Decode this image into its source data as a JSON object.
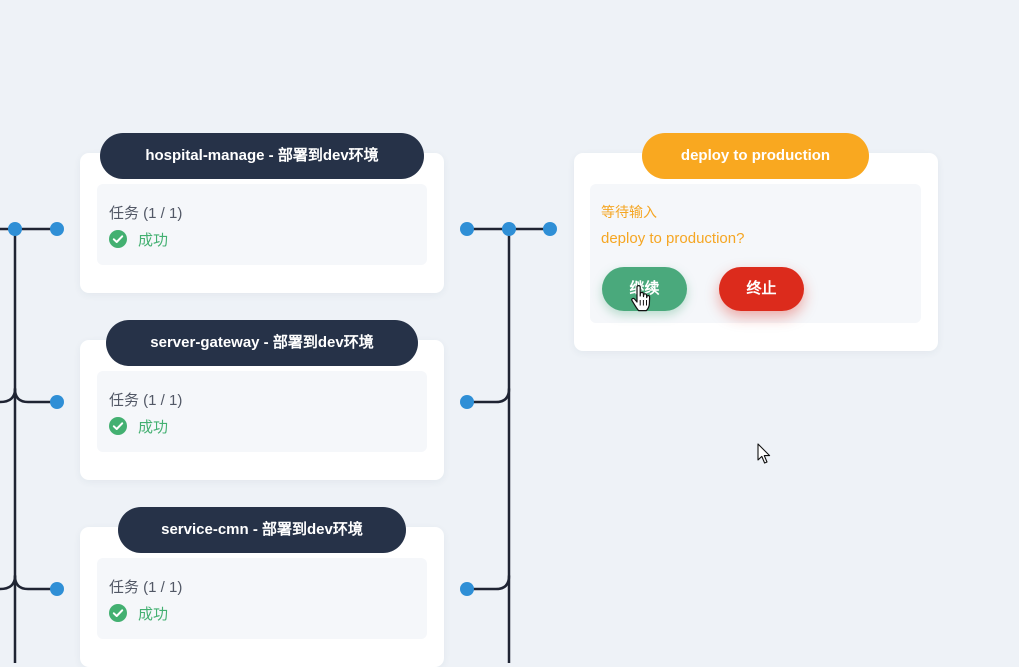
{
  "pipeline": {
    "stages": [
      {
        "title": "hospital-manage - 部署到dev环境",
        "task_count": "任务 (1 / 1)",
        "status": "成功",
        "status_icon": "check-circle-icon"
      },
      {
        "title": "server-gateway - 部署到dev环境",
        "task_count": "任务 (1 / 1)",
        "status": "成功",
        "status_icon": "check-circle-icon"
      },
      {
        "title": "service-cmn - 部署到dev环境",
        "task_count": "任务 (1 / 1)",
        "status": "成功",
        "status_icon": "check-circle-icon"
      }
    ],
    "input_stage": {
      "title": "deploy to production",
      "state_label": "等待输入",
      "message": "deploy to production?",
      "continue_label": "继续",
      "abort_label": "终止"
    }
  },
  "colors": {
    "page_background": "#eef2f7",
    "stage_title_dark": "#263248",
    "stage_title_waiting": "#f9a820",
    "success": "#43b071",
    "waiting_text": "#f5a623",
    "continue_button": "#4aa97c",
    "abort_button": "#dc2b1c",
    "connector_line": "#1f2433",
    "connector_node": "#2f8fd6"
  }
}
